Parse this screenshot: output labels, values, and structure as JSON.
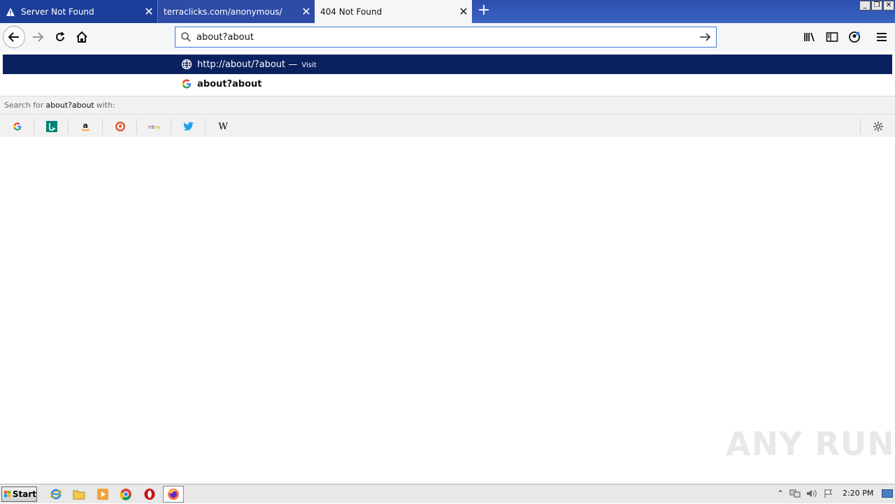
{
  "tabs": [
    {
      "title": "Server Not Found",
      "icon": "warning-icon"
    },
    {
      "title": "terraclicks.com/anonymous/"
    },
    {
      "title": "404 Not Found"
    }
  ],
  "urlbar": {
    "value": "about?about"
  },
  "dropdown": {
    "rows": [
      {
        "text": "http://about/?about —",
        "action": "Visit",
        "icon": "globe-icon"
      },
      {
        "text": "about?about",
        "icon": "google-icon"
      }
    ],
    "search_prefix": "Search for",
    "search_query": "about?about",
    "search_suffix": "with:",
    "engines": [
      "Google",
      "Bing",
      "Amazon",
      "DuckDuckGo",
      "eBay",
      "Twitter",
      "Wikipedia"
    ]
  },
  "watermark": "ANY RUN",
  "taskbar": {
    "start_label": "Start",
    "clock": "2:20 PM"
  },
  "colors": {
    "accent": "#0a2160",
    "tabstrip": "#3a63c2"
  }
}
